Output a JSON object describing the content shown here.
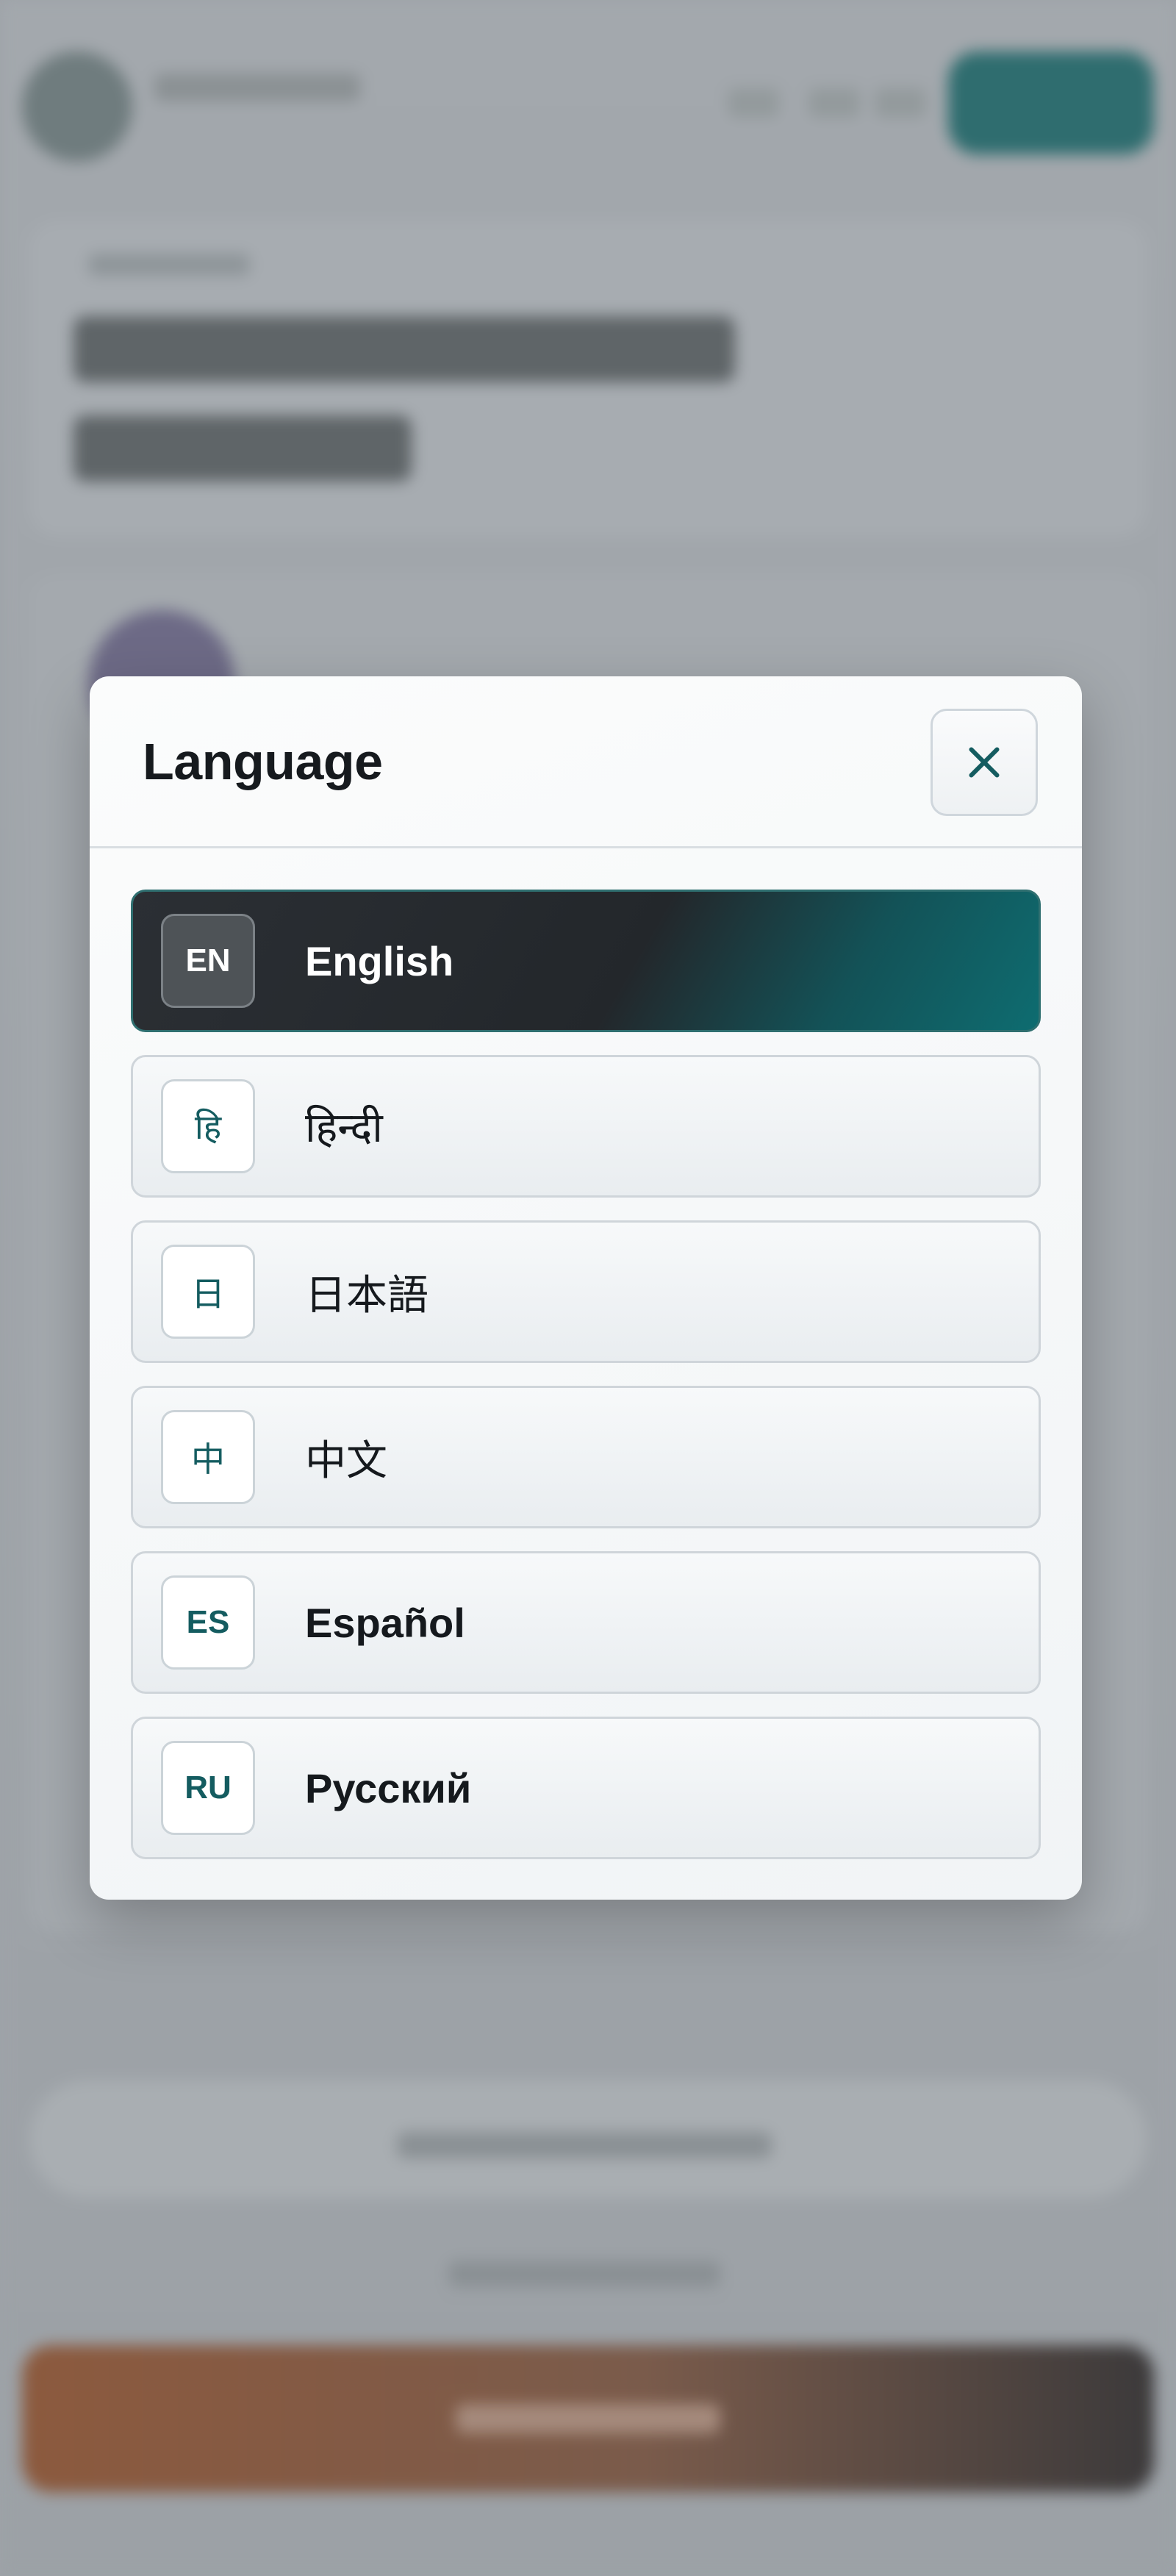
{
  "modal": {
    "title": "Language",
    "close_icon": "close-icon"
  },
  "languages": [
    {
      "code": "EN",
      "label": "English",
      "selected": true
    },
    {
      "code": "हि",
      "label": "हिन्दी",
      "selected": false
    },
    {
      "code": "日",
      "label": "日本語",
      "selected": false
    },
    {
      "code": "中",
      "label": "中文",
      "selected": false
    },
    {
      "code": "ES",
      "label": "Español",
      "selected": false
    },
    {
      "code": "RU",
      "label": "Русский",
      "selected": false
    }
  ],
  "colors": {
    "accent": "#0e6c70",
    "active_dark": "#23272b",
    "badge_text": "#145c60",
    "title_text": "#161a1e"
  }
}
